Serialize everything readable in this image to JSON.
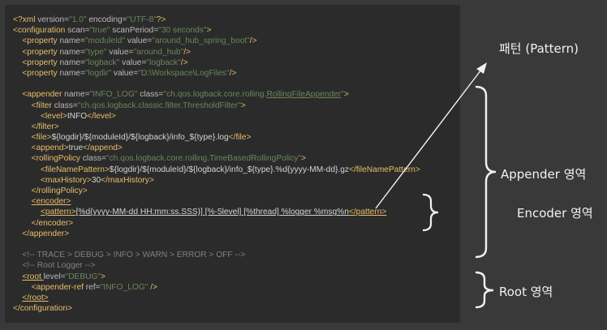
{
  "code_lines": [
    {
      "kind": "decl",
      "parts": [
        [
          "tag",
          "<?xml "
        ],
        [
          "attr",
          "version="
        ],
        [
          "val",
          "\"1.0\""
        ],
        [
          "attr",
          " encoding="
        ],
        [
          "val",
          "\"UTF-8\""
        ],
        [
          "tag",
          "?>"
        ]
      ]
    },
    {
      "kind": "code",
      "parts": [
        [
          "tag",
          "<configuration "
        ],
        [
          "attr",
          "scan="
        ],
        [
          "val",
          "\"true\""
        ],
        [
          "attr",
          " scanPeriod="
        ],
        [
          "val",
          "\"30 seconds\""
        ],
        [
          "tag",
          ">"
        ]
      ]
    },
    {
      "kind": "code",
      "parts": [
        [
          "txt",
          "    "
        ],
        [
          "tag",
          "<property "
        ],
        [
          "attr",
          "name="
        ],
        [
          "val",
          "\"moduleId\""
        ],
        [
          "attr",
          " value="
        ],
        [
          "val",
          "\"around_hub_spring_boot\""
        ],
        [
          "tag",
          "/>"
        ]
      ]
    },
    {
      "kind": "code",
      "parts": [
        [
          "txt",
          "    "
        ],
        [
          "tag",
          "<property "
        ],
        [
          "attr",
          "name="
        ],
        [
          "val",
          "\"type\""
        ],
        [
          "attr",
          " value="
        ],
        [
          "val",
          "\"around_hub\""
        ],
        [
          "tag",
          "/>"
        ]
      ]
    },
    {
      "kind": "code",
      "parts": [
        [
          "txt",
          "    "
        ],
        [
          "tag",
          "<property "
        ],
        [
          "attr",
          "name="
        ],
        [
          "val",
          "\"logback\""
        ],
        [
          "attr",
          " value="
        ],
        [
          "val",
          "\"logback\""
        ],
        [
          "tag",
          "/>"
        ]
      ]
    },
    {
      "kind": "code",
      "parts": [
        [
          "txt",
          "    "
        ],
        [
          "tag",
          "<property "
        ],
        [
          "attr",
          "name="
        ],
        [
          "val",
          "\"logdir\""
        ],
        [
          "attr",
          " value="
        ],
        [
          "val",
          "\"D:\\Workspace\\LogFiles\""
        ],
        [
          "tag",
          "/>"
        ]
      ]
    },
    {
      "kind": "blank",
      "parts": [
        [
          "txt",
          " "
        ]
      ]
    },
    {
      "kind": "code",
      "parts": [
        [
          "txt",
          "    "
        ],
        [
          "tag",
          "<appender "
        ],
        [
          "attr",
          "name="
        ],
        [
          "val",
          "\"INFO_LOG\""
        ],
        [
          "attr",
          " class="
        ],
        [
          "val",
          "\"ch.qos.logback.core.rolling."
        ],
        [
          "valul",
          "RollingFileAppender"
        ],
        [
          "val",
          "\""
        ],
        [
          "tag",
          ">"
        ]
      ]
    },
    {
      "kind": "code",
      "parts": [
        [
          "txt",
          "        "
        ],
        [
          "tag",
          "<filter "
        ],
        [
          "attr",
          "class="
        ],
        [
          "val",
          "\"ch.qos.logback.classic.filter.ThresholdFilter\""
        ],
        [
          "tag",
          ">"
        ]
      ]
    },
    {
      "kind": "code",
      "parts": [
        [
          "txt",
          "            "
        ],
        [
          "tag",
          "<level>"
        ],
        [
          "txt",
          "INFO"
        ],
        [
          "tag",
          "</level>"
        ]
      ]
    },
    {
      "kind": "code",
      "parts": [
        [
          "txt",
          "        "
        ],
        [
          "tag",
          "</filter>"
        ]
      ]
    },
    {
      "kind": "code",
      "parts": [
        [
          "txt",
          "        "
        ],
        [
          "tag",
          "<file>"
        ],
        [
          "txt",
          "${logdir}/${moduleId}/${logback}/info_${type}.log"
        ],
        [
          "tag",
          "</file>"
        ]
      ]
    },
    {
      "kind": "code",
      "parts": [
        [
          "txt",
          "        "
        ],
        [
          "tag",
          "<append>"
        ],
        [
          "txt",
          "true"
        ],
        [
          "tag",
          "</append>"
        ]
      ]
    },
    {
      "kind": "code",
      "parts": [
        [
          "txt",
          "        "
        ],
        [
          "tag",
          "<rollingPolicy "
        ],
        [
          "attr",
          "class="
        ],
        [
          "val",
          "\"ch.qos.logback.core.rolling.TimeBasedRollingPolicy\""
        ],
        [
          "tag",
          ">"
        ]
      ]
    },
    {
      "kind": "code",
      "parts": [
        [
          "txt",
          "            "
        ],
        [
          "tag",
          "<fileNamePattern>"
        ],
        [
          "txt",
          "${logdir}/${moduleId}/${logback}/info_${type}.%d{yyyy-MM-dd}.gz"
        ],
        [
          "tag",
          "</fileNamePattern>"
        ]
      ]
    },
    {
      "kind": "code",
      "parts": [
        [
          "txt",
          "            "
        ],
        [
          "tag",
          "<maxHistory>"
        ],
        [
          "txt",
          "30"
        ],
        [
          "tag",
          "</maxHistory>"
        ]
      ]
    },
    {
      "kind": "code",
      "parts": [
        [
          "txt",
          "        "
        ],
        [
          "tag",
          "</rollingPolicy>"
        ]
      ]
    },
    {
      "kind": "code",
      "parts": [
        [
          "txt",
          "        "
        ],
        [
          "tagul",
          "<encoder>"
        ]
      ]
    },
    {
      "kind": "code",
      "parts": [
        [
          "txt",
          "            "
        ],
        [
          "tagul",
          "<pattern>"
        ],
        [
          "txtul",
          "[%d{yyyy-MM-dd HH:mm:ss.SSS}] [%-5level] [%thread] %logger %msg%n"
        ],
        [
          "tagul",
          "</pattern>"
        ]
      ]
    },
    {
      "kind": "code",
      "parts": [
        [
          "txt",
          "        "
        ],
        [
          "tag",
          "</encoder>"
        ]
      ]
    },
    {
      "kind": "code",
      "parts": [
        [
          "txt",
          "    "
        ],
        [
          "tag",
          "</appender>"
        ]
      ]
    },
    {
      "kind": "blank",
      "parts": [
        [
          "txt",
          " "
        ]
      ]
    },
    {
      "kind": "code",
      "parts": [
        [
          "txt",
          "    "
        ],
        [
          "cmt",
          "<!-- TRACE > DEBUG > INFO > WARN > ERROR > OFF -->"
        ]
      ]
    },
    {
      "kind": "code",
      "parts": [
        [
          "txt",
          "    "
        ],
        [
          "cmt",
          "<!-- Root Logger -->"
        ]
      ]
    },
    {
      "kind": "code",
      "parts": [
        [
          "txt",
          "    "
        ],
        [
          "tagul",
          "<root "
        ],
        [
          "attr",
          "level="
        ],
        [
          "val",
          "\"DEBUG\""
        ],
        [
          "tag",
          ">"
        ]
      ]
    },
    {
      "kind": "code",
      "parts": [
        [
          "txt",
          "        "
        ],
        [
          "tag",
          "<appender-ref "
        ],
        [
          "attr",
          "ref="
        ],
        [
          "val",
          "\"INFO_LOG\""
        ],
        [
          "tag",
          " />"
        ]
      ]
    },
    {
      "kind": "code",
      "parts": [
        [
          "txt",
          "    "
        ],
        [
          "tagul",
          "</root>"
        ]
      ]
    },
    {
      "kind": "code",
      "parts": [
        [
          "tag",
          "</configuration>"
        ]
      ]
    }
  ],
  "annotations": {
    "pattern": "패턴 (Pattern)",
    "appender": "Appender 영역",
    "encoder": "Encoder 영역",
    "root": "Root 영역"
  }
}
